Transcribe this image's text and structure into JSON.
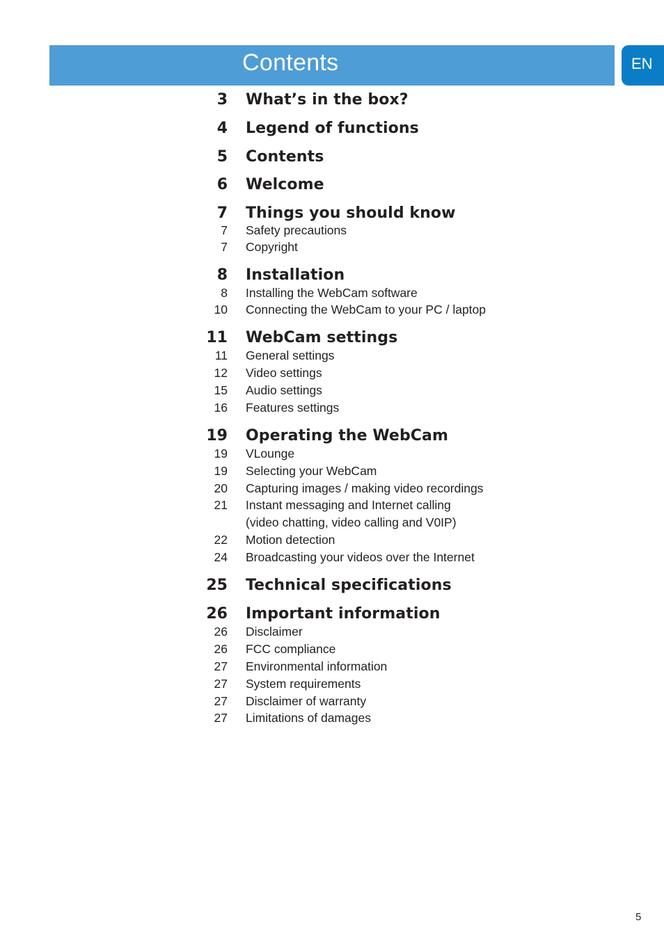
{
  "header": {
    "title": "Contents",
    "language": "EN"
  },
  "toc": [
    {
      "page": "3",
      "title": "What’s in the box?",
      "subs": []
    },
    {
      "page": "4",
      "title": "Legend of functions",
      "subs": []
    },
    {
      "page": "5",
      "title": "Contents",
      "subs": []
    },
    {
      "page": "6",
      "title": "Welcome",
      "subs": []
    },
    {
      "page": "7",
      "title": "Things you should know",
      "subs": [
        {
          "page": "7",
          "title": "Safety precautions"
        },
        {
          "page": "7",
          "title": "Copyright"
        }
      ]
    },
    {
      "page": "8",
      "title": "Installation",
      "subs": [
        {
          "page": "8",
          "title": "Installing the WebCam software"
        },
        {
          "page": "10",
          "title": "Connecting the WebCam to your PC / laptop"
        }
      ]
    },
    {
      "page": "11",
      "title": "WebCam settings",
      "subs": [
        {
          "page": "11",
          "title": "General settings"
        },
        {
          "page": "12",
          "title": "Video settings"
        },
        {
          "page": "15",
          "title": "Audio settings"
        },
        {
          "page": "16",
          "title": "Features settings"
        }
      ]
    },
    {
      "page": "19",
      "title": "Operating the WebCam",
      "subs": [
        {
          "page": "19",
          "title": "VLounge"
        },
        {
          "page": "19",
          "title": "Selecting your WebCam"
        },
        {
          "page": "20",
          "title": "Capturing images / making video recordings"
        },
        {
          "page": "21",
          "title": "Instant messaging and Internet calling"
        },
        {
          "page": "",
          "title": "(video chatting, video calling and V0IP)"
        },
        {
          "page": "22",
          "title": "Motion detection"
        },
        {
          "page": "24",
          "title": "Broadcasting your videos over the Internet"
        }
      ]
    },
    {
      "page": "25",
      "title": "Technical specifications",
      "subs": []
    },
    {
      "page": "26",
      "title": "Important information",
      "subs": [
        {
          "page": "26",
          "title": "Disclaimer"
        },
        {
          "page": "26",
          "title": "FCC compliance"
        },
        {
          "page": "27",
          "title": "Environmental information"
        },
        {
          "page": "27",
          "title": "System requirements"
        },
        {
          "page": "27",
          "title": "Disclaimer of warranty"
        },
        {
          "page": "27",
          "title": "Limitations of damages"
        }
      ]
    }
  ],
  "footer": {
    "page_number": "5"
  }
}
